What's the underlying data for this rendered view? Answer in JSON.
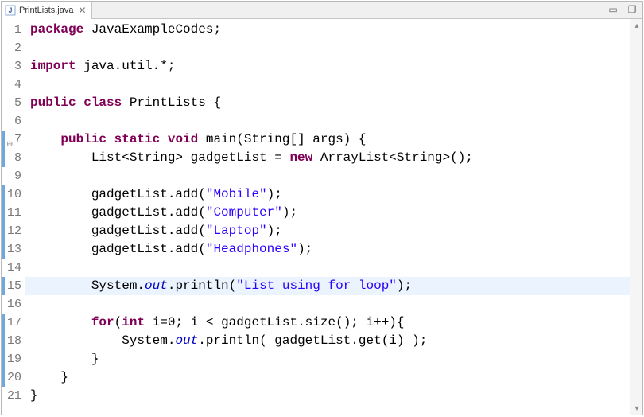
{
  "tab": {
    "filename": "PrintLists.java"
  },
  "gutter": {
    "lines": [
      "1",
      "2",
      "3",
      "4",
      "5",
      "6",
      "7",
      "8",
      "9",
      "10",
      "11",
      "12",
      "13",
      "14",
      "15",
      "16",
      "17",
      "18",
      "19",
      "20",
      "21"
    ],
    "override_glyph_line": 6
  },
  "code": {
    "lines": [
      {
        "n": 1,
        "segs": [
          {
            "c": "kw",
            "t": "package"
          },
          {
            "c": "txt",
            "t": " JavaExampleCodes;"
          }
        ]
      },
      {
        "n": 2,
        "segs": []
      },
      {
        "n": 3,
        "segs": [
          {
            "c": "kw",
            "t": "import"
          },
          {
            "c": "txt",
            "t": " java.util.*;"
          }
        ]
      },
      {
        "n": 4,
        "segs": []
      },
      {
        "n": 5,
        "segs": [
          {
            "c": "kw",
            "t": "public"
          },
          {
            "c": "txt",
            "t": " "
          },
          {
            "c": "kw",
            "t": "class"
          },
          {
            "c": "txt",
            "t": " PrintLists {"
          }
        ]
      },
      {
        "n": 6,
        "segs": []
      },
      {
        "n": 7,
        "segs": [
          {
            "c": "txt",
            "t": "    "
          },
          {
            "c": "kw",
            "t": "public"
          },
          {
            "c": "txt",
            "t": " "
          },
          {
            "c": "kw",
            "t": "static"
          },
          {
            "c": "txt",
            "t": " "
          },
          {
            "c": "kw",
            "t": "void"
          },
          {
            "c": "txt",
            "t": " main(String[] args) {"
          }
        ]
      },
      {
        "n": 8,
        "segs": [
          {
            "c": "txt",
            "t": "        List<String> gadgetList = "
          },
          {
            "c": "kw",
            "t": "new"
          },
          {
            "c": "txt",
            "t": " ArrayList<String>();"
          }
        ]
      },
      {
        "n": 9,
        "segs": []
      },
      {
        "n": 10,
        "segs": [
          {
            "c": "txt",
            "t": "        gadgetList.add("
          },
          {
            "c": "str",
            "t": "\"Mobile\""
          },
          {
            "c": "txt",
            "t": ");"
          }
        ]
      },
      {
        "n": 11,
        "segs": [
          {
            "c": "txt",
            "t": "        gadgetList.add("
          },
          {
            "c": "str",
            "t": "\"Computer\""
          },
          {
            "c": "txt",
            "t": ");"
          }
        ]
      },
      {
        "n": 12,
        "segs": [
          {
            "c": "txt",
            "t": "        gadgetList.add("
          },
          {
            "c": "str",
            "t": "\"Laptop\""
          },
          {
            "c": "txt",
            "t": ");"
          }
        ]
      },
      {
        "n": 13,
        "segs": [
          {
            "c": "txt",
            "t": "        gadgetList.add("
          },
          {
            "c": "str",
            "t": "\"Headphones\""
          },
          {
            "c": "txt",
            "t": ");"
          }
        ]
      },
      {
        "n": 14,
        "segs": []
      },
      {
        "n": 15,
        "hl": true,
        "segs": [
          {
            "c": "txt",
            "t": "        System."
          },
          {
            "c": "fld",
            "t": "out"
          },
          {
            "c": "txt",
            "t": ".println("
          },
          {
            "c": "str",
            "t": "\"List using for loop\""
          },
          {
            "c": "txt",
            "t": ");"
          }
        ]
      },
      {
        "n": 16,
        "segs": []
      },
      {
        "n": 17,
        "segs": [
          {
            "c": "txt",
            "t": "        "
          },
          {
            "c": "kw",
            "t": "for"
          },
          {
            "c": "txt",
            "t": "("
          },
          {
            "c": "kw",
            "t": "int"
          },
          {
            "c": "txt",
            "t": " i=0; i < gadgetList.size(); i++){"
          }
        ]
      },
      {
        "n": 18,
        "segs": [
          {
            "c": "txt",
            "t": "            System."
          },
          {
            "c": "fld",
            "t": "out"
          },
          {
            "c": "txt",
            "t": ".println( gadgetList.get(i) );"
          }
        ]
      },
      {
        "n": 19,
        "segs": [
          {
            "c": "txt",
            "t": "        }"
          }
        ]
      },
      {
        "n": 20,
        "segs": [
          {
            "c": "txt",
            "t": "    }"
          }
        ]
      },
      {
        "n": 21,
        "segs": [
          {
            "c": "txt",
            "t": "}"
          }
        ]
      }
    ],
    "blue_mark_lines": [
      7,
      8,
      10,
      11,
      12,
      13,
      15,
      17,
      18,
      19,
      20
    ]
  },
  "window_controls": {
    "minimize": "▭",
    "restore": "❐"
  }
}
